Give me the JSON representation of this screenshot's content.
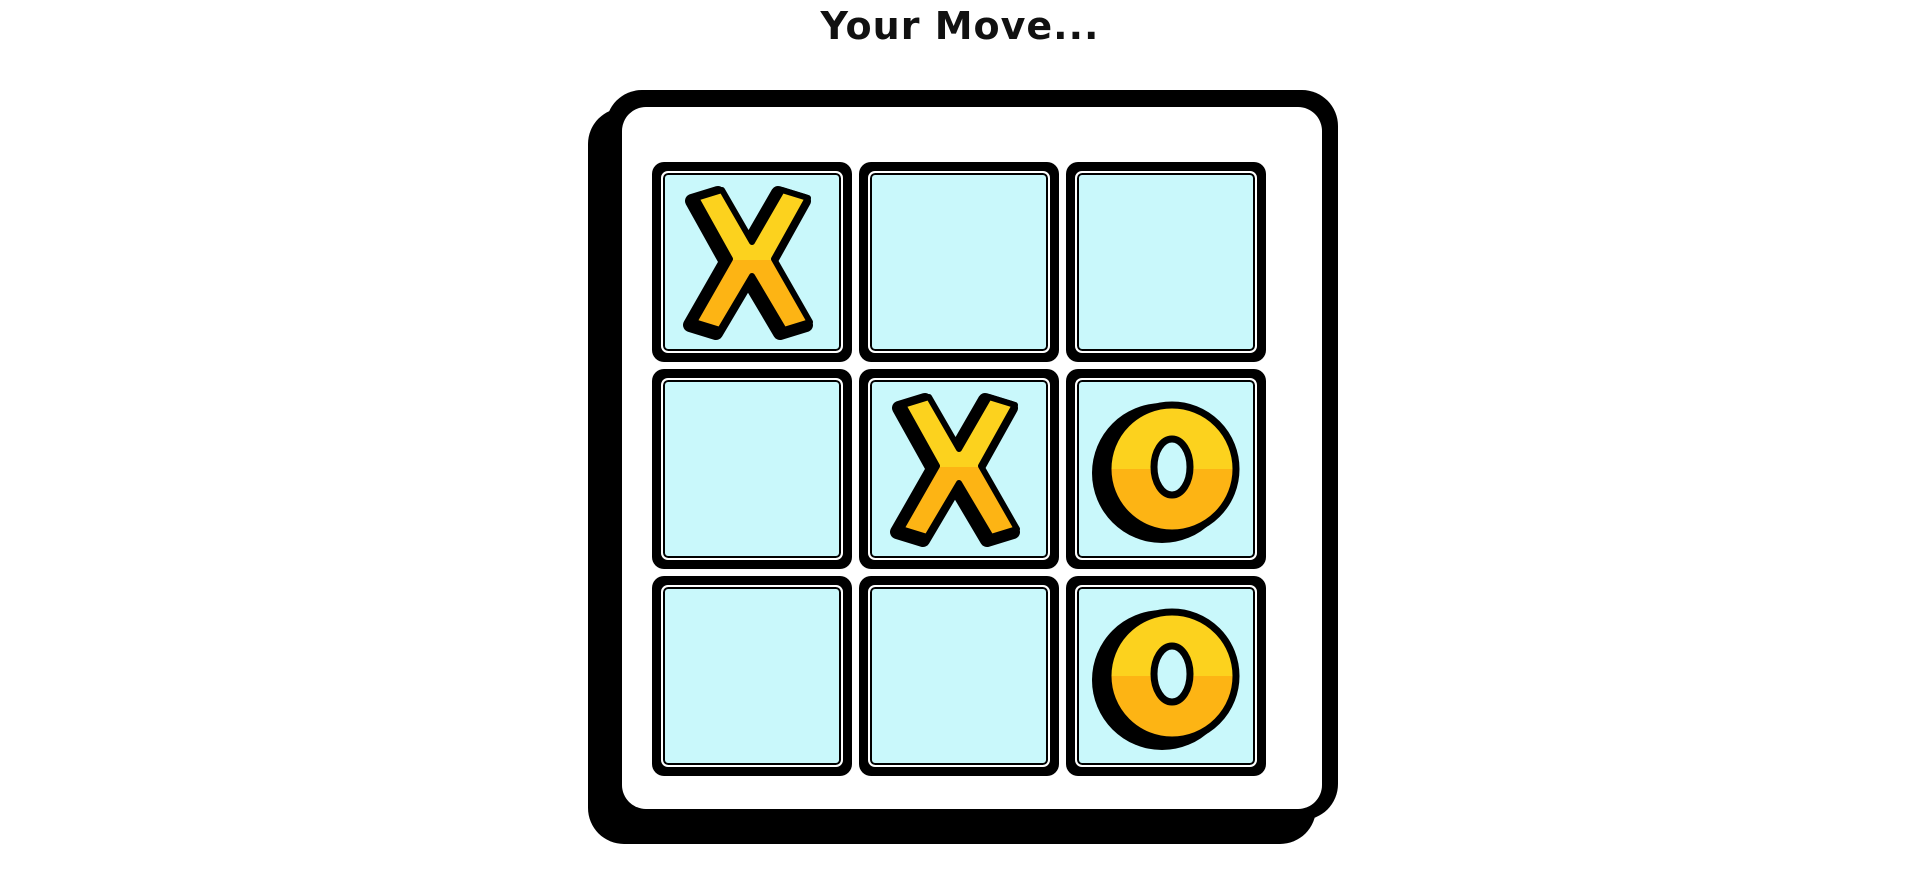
{
  "header": {
    "title": "Your Move..."
  },
  "board": {
    "rows": 3,
    "cols": 3,
    "cells": [
      "X",
      "",
      "",
      "",
      "X",
      "O",
      "",
      "",
      "O"
    ]
  },
  "colors": {
    "cell_fill": "#c9f8fb",
    "mark_yellow": "#fcd21e",
    "mark_orange": "#fdb414",
    "outline": "#000000"
  },
  "icons": {
    "x_mark": "x-piece-icon",
    "o_mark": "o-piece-icon"
  }
}
